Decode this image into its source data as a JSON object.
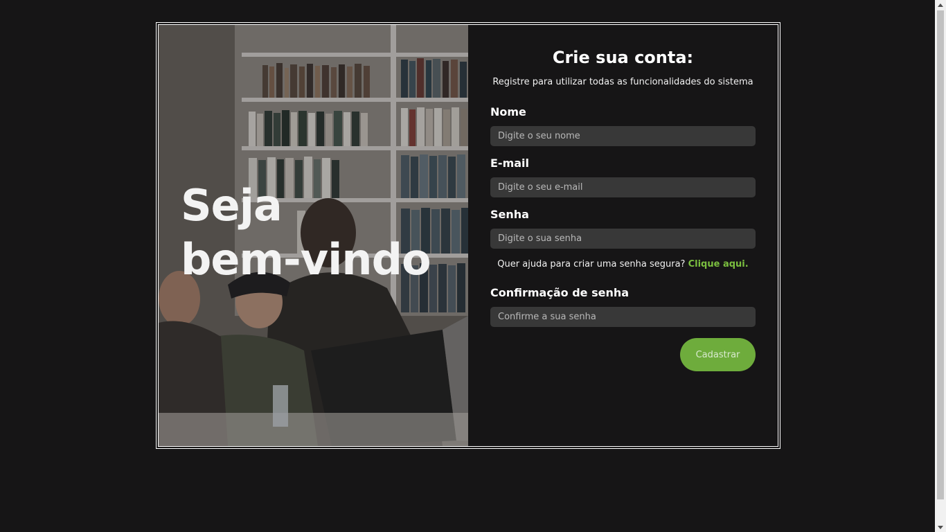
{
  "hero": {
    "line1": "Seja",
    "line2": "bem-vindo"
  },
  "form": {
    "title": "Crie sua conta:",
    "subtitle": "Registre para utilizar todas as funcionalidades do sistema",
    "fields": {
      "nome": {
        "label": "Nome",
        "placeholder": "Digite o seu nome"
      },
      "email": {
        "label": "E-mail",
        "placeholder": "Digite o seu e-mail"
      },
      "senha": {
        "label": "Senha",
        "placeholder": "Digite o sua senha"
      },
      "confirmacao": {
        "label": "Confirmação de senha",
        "placeholder": "Confirme a sua senha"
      }
    },
    "help": {
      "text": "Quer ajuda para criar uma senha segura?",
      "link": "Clique aqui."
    },
    "submit_label": "Cadastrar"
  },
  "colors": {
    "background": "#161516",
    "accent": "#6eac3c",
    "link": "#7bbf3f",
    "input_bg": "#383838"
  },
  "icons": {
    "scroll_up": "chevron-up-icon",
    "scroll_down": "chevron-down-icon"
  }
}
